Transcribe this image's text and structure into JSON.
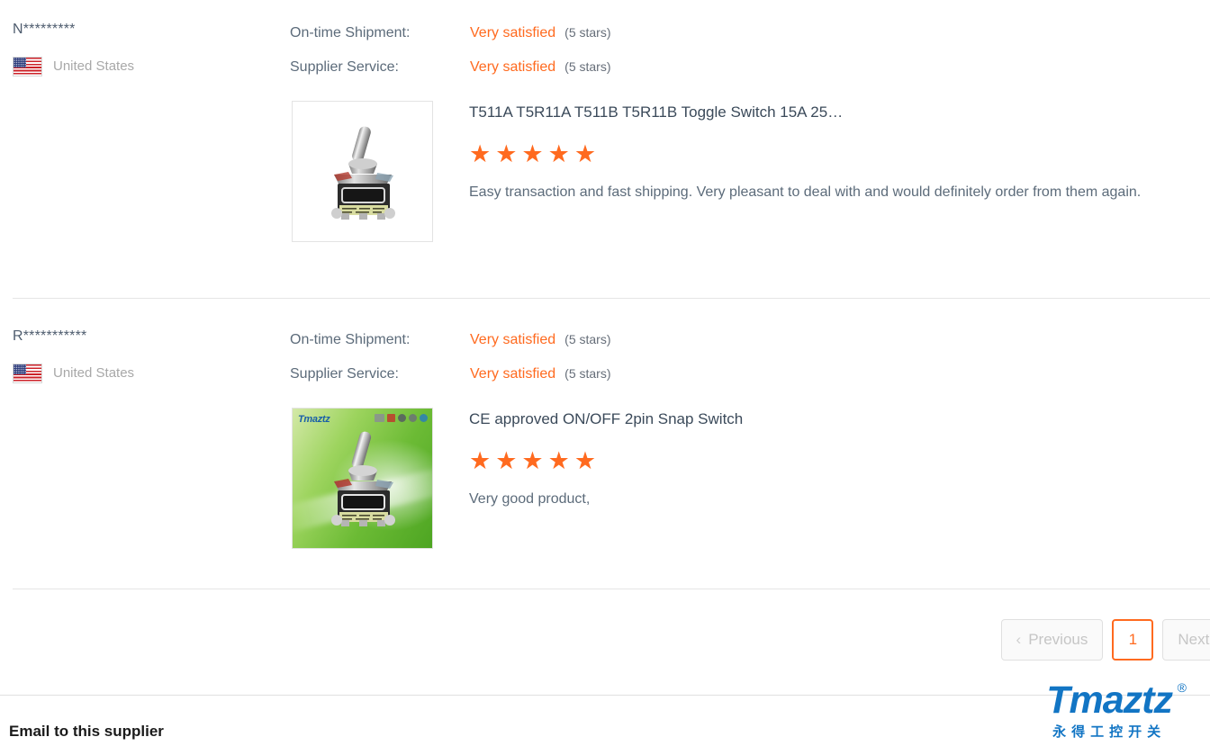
{
  "colors": {
    "accent_orange": "#ff6a1f",
    "brand_blue": "#1275c4",
    "label_gray": "#5c6b7a",
    "muted_gray": "#a8a8a8",
    "divider": "#e6e6e6"
  },
  "reviews": [
    {
      "reviewer_name": "N*********",
      "country": "United States",
      "flag_icon": "us-flag-icon",
      "ratings": [
        {
          "label": "On-time Shipment:",
          "value": "Very satisfied",
          "stars_text": "(5 stars)"
        },
        {
          "label": "Supplier Service:",
          "value": "Very satisfied",
          "stars_text": "(5 stars)"
        }
      ],
      "product_title": "T511A T5R11A T511B T5R11B Toggle Switch 15A 25…",
      "star_rating": 5,
      "stars_glyphs": "★★★★★",
      "review_text": "Easy transaction and fast shipping. Very pleasant to deal with and would definitely order from them again.",
      "thumbnail_style": "white",
      "thumbnail_alt": "toggle-switch-photo"
    },
    {
      "reviewer_name": "R***********",
      "country": "United States",
      "flag_icon": "us-flag-icon",
      "ratings": [
        {
          "label": "On-time Shipment:",
          "value": "Very satisfied",
          "stars_text": "(5 stars)"
        },
        {
          "label": "Supplier Service:",
          "value": "Very satisfied",
          "stars_text": "(5 stars)"
        }
      ],
      "product_title": "CE approved ON/OFF 2pin Snap Switch",
      "star_rating": 5,
      "stars_glyphs": "★★★★★",
      "review_text": "Very good product,",
      "thumbnail_style": "green",
      "thumbnail_brand": "Tmaztz",
      "thumbnail_alt": "toggle-switch-photo-green-background"
    }
  ],
  "pagination": {
    "previous_label": "Previous",
    "previous_chevron": "‹",
    "current_page": "1",
    "next_label": "Next",
    "next_chevron": "›"
  },
  "footer": {
    "email_supplier_label": "Email to this supplier",
    "brand_wordmark": "Tmaztz",
    "brand_registered": "®",
    "brand_subtitle": "永得工控开关"
  }
}
